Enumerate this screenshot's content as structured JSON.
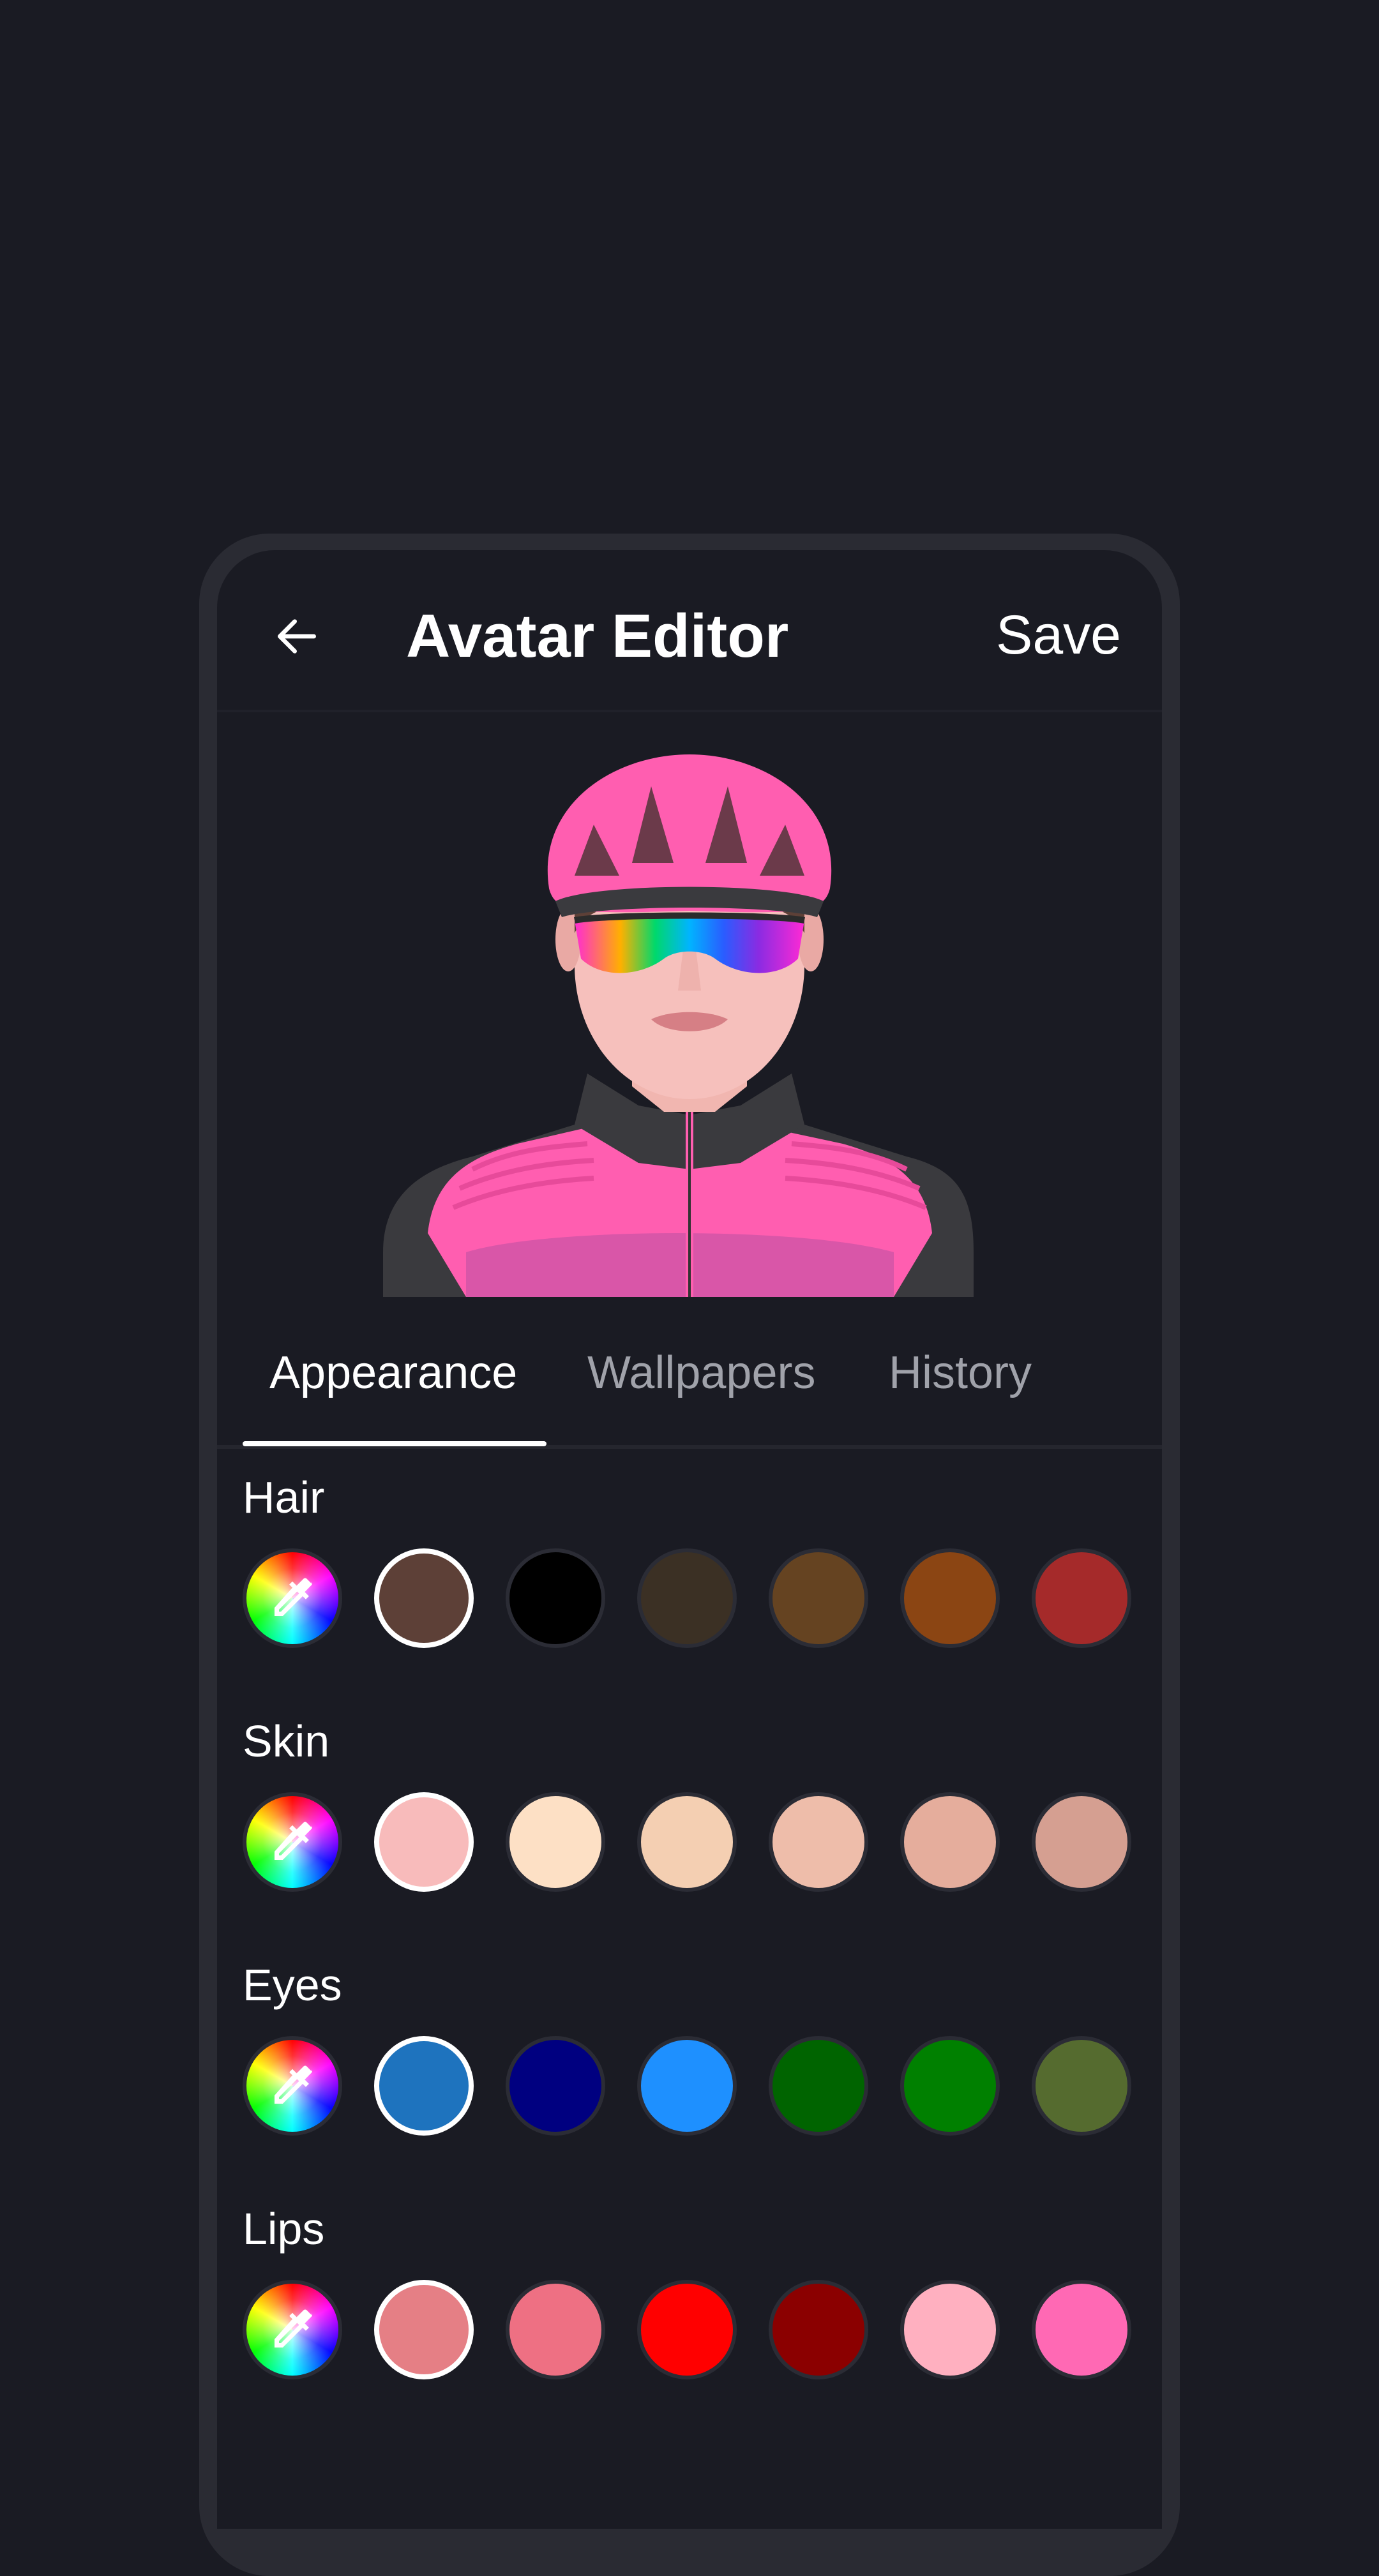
{
  "appbar": {
    "title": "Avatar Editor",
    "save_label": "Save"
  },
  "tabs": [
    {
      "label": "Appearance",
      "active": true
    },
    {
      "label": "Wallpapers",
      "active": false
    },
    {
      "label": "History",
      "active": false
    }
  ],
  "sections": [
    {
      "label": "Hair",
      "colors": [
        "#5d4037",
        "#000000",
        "#3b3024",
        "#654321",
        "#8b4513",
        "#a52a2a"
      ],
      "selected_index": 0
    },
    {
      "label": "Skin",
      "colors": [
        "#f8bbbb",
        "#fde0c5",
        "#f4cfb2",
        "#eebdaa",
        "#e5ad9c",
        "#d59f91"
      ],
      "selected_index": 0
    },
    {
      "label": "Eyes",
      "colors": [
        "#1e73be",
        "#000080",
        "#1e90ff",
        "#006400",
        "#008000",
        "#556b2f"
      ],
      "selected_index": 0
    },
    {
      "label": "Lips",
      "colors": [
        "#e57f85",
        "#ee7083",
        "#ff0000",
        "#8b0000",
        "#ffb0c0",
        "#ff69b4"
      ],
      "selected_index": 0
    }
  ],
  "icons": {
    "back": "arrow-left-icon",
    "picker": "eyedropper-icon"
  },
  "colors": {
    "background": "#1a1b23",
    "frame": "#2a2b33",
    "accent_pink": "#ff5eb0"
  }
}
